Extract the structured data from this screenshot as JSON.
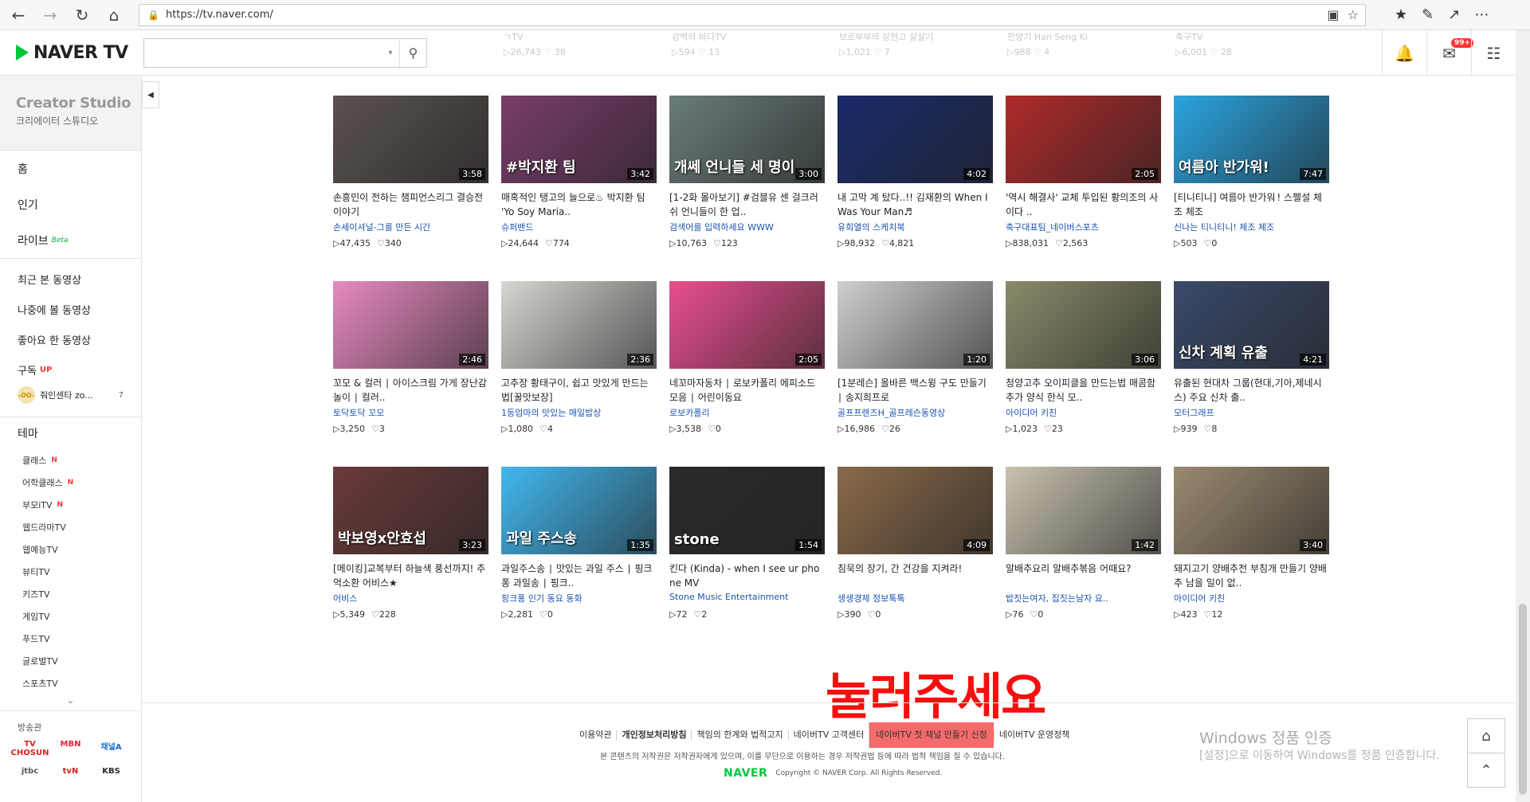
{
  "browser": {
    "url": "https://tv.naver.com/"
  },
  "header": {
    "logo": "NAVER TV",
    "search_placeholder": "",
    "badge": "99+",
    "ghost_row": [
      {
        "title": "ㄱTV",
        "stats": "▷26,743  ♡ 38"
      },
      {
        "title": "강백의 바다TV",
        "stats": "▷594  ♡ 13"
      },
      {
        "title": "브로부부의 장현고 살살기",
        "stats": "▷1,021  ♡ 7"
      },
      {
        "title": "한양기 Han Seng Ki",
        "stats": "▷988  ♡ 4"
      },
      {
        "title": "축구TV",
        "stats": "▷6,001  ♡ 28"
      }
    ]
  },
  "sidebar": {
    "studio_title": "Creator Studio",
    "studio_sub": "크리에이터 스튜디오",
    "home": "홈",
    "popular": "인기",
    "live": "라이브",
    "live_badge": "Beta",
    "recent": "최근 본 동영상",
    "later": "나중에 볼 동영상",
    "liked": "좋아요 한 동영상",
    "subscribe": "구독",
    "subscribe_badge": "UP",
    "sub_channel": "줘인센타 zo...",
    "sub_avatar": "-OO-",
    "sub_count": "7",
    "theme": "테마",
    "themes": [
      {
        "label": "클래스",
        "badge": "N"
      },
      {
        "label": "어학클래스",
        "badge": "N"
      },
      {
        "label": "부모iTV",
        "badge": "N"
      },
      {
        "label": "웹드라마TV",
        "badge": ""
      },
      {
        "label": "웹예능TV",
        "badge": ""
      },
      {
        "label": "뷰티TV",
        "badge": ""
      },
      {
        "label": "키즈TV",
        "badge": ""
      },
      {
        "label": "게임TV",
        "badge": ""
      },
      {
        "label": "푸드TV",
        "badge": ""
      },
      {
        "label": "글로벌TV",
        "badge": ""
      },
      {
        "label": "스포츠TV",
        "badge": ""
      }
    ],
    "broadcast_title": "방송관",
    "broadcasters": [
      "TV CHOSUN",
      "MBN",
      "채널A",
      "jtbc",
      "tvN",
      "KBS"
    ],
    "broadcaster_colors": [
      "#d22",
      "#e23",
      "#1a6bd1",
      "#555",
      "#c22",
      "#2a2a2a"
    ]
  },
  "videos": [
    {
      "title": "손흥민이 전하는 챔피언스리그 결승전 이야기",
      "channel": "손세이셔널-그를 만든 시간",
      "views": "▷47,435",
      "likes": "♡340",
      "duration": "3:58",
      "color": "#5a5250",
      "caption": ""
    },
    {
      "title": "매혹적인 탱고의 늘으로♨ 박지환 팀 'Yo Soy Maria..",
      "channel": "슈퍼밴드",
      "views": "▷24,644",
      "likes": "♡774",
      "duration": "3:42",
      "color": "#7a3d6b",
      "caption": "#박지환 팀"
    },
    {
      "title": "[1-2화 몰아보기] #검블유 센 걸크러쉬 언니들이 한 업..",
      "channel": "검색어를 입력하세요 WWW",
      "views": "▷10,763",
      "likes": "♡123",
      "duration": "3:00",
      "color": "#6a7c7a",
      "caption": "개쎄 언니들 세 명이"
    },
    {
      "title": "내 고막 계 탔다..!! 김재환의 When I Was Your Man♬",
      "channel": "유희열의 스케치북",
      "views": "▷98,932",
      "likes": "♡4,821",
      "duration": "4:02",
      "color": "#1a2a6a",
      "caption": ""
    },
    {
      "title": "'역시 해결사' 교체 투입된 황의조의 사이다 ..",
      "channel": "축구대표팀_네이버스포츠",
      "views": "▷838,031",
      "likes": "♡2,563",
      "duration": "2:05",
      "color": "#b02a2a",
      "caption": ""
    },
    {
      "title": "[티니티니] 여름아 반가워 ! 스펠설 체조 체조",
      "channel": "신나는 티니티니! 체조 체조",
      "views": "▷503",
      "likes": "♡0",
      "duration": "7:47",
      "color": "#2aa4e0",
      "caption": "여름아 반가워!"
    },
    {
      "title": "꼬모 & 컬러 ∣ 아이스크림 가게 장난감 놀이 ∣ 컬러..",
      "channel": "토닥토닥 꼬모",
      "views": "▷3,250",
      "likes": "♡3",
      "duration": "2:46",
      "color": "#e88ac0",
      "caption": ""
    },
    {
      "title": "고추장 황태구이, 쉽고 맛있게 만드는법[꿀맛보장]",
      "channel": "1등엄마의 맛있는 매일밥상",
      "views": "▷1,080",
      "likes": "♡4",
      "duration": "2:36",
      "color": "#d8d6d2",
      "caption": ""
    },
    {
      "title": "네꼬마자동차 ∣ 로보카폴리 에피소드 모음 ∣ 어린이동요",
      "channel": "로보카폴리",
      "views": "▷3,538",
      "likes": "♡0",
      "duration": "2:05",
      "color": "#e94e8e",
      "caption": ""
    },
    {
      "title": "[1분레슨] 올바른 백스윙 구도 만들기 ∣ 송지희프로",
      "channel": "골프프렌즈H_골프레슨동영상",
      "views": "▷16,986",
      "likes": "♡26",
      "duration": "1:20",
      "color": "#cfcfcf",
      "caption": ""
    },
    {
      "title": "청양고추 오이피클을 만드는법 매콤함 추가 양식 한식 모..",
      "channel": "아이디어 키친",
      "views": "▷1,023",
      "likes": "♡23",
      "duration": "3:06",
      "color": "#8a8a6a",
      "caption": ""
    },
    {
      "title": "유출된 현대차 그룹(현대,기아,제네시스) 주요 신차 출..",
      "channel": "모터그래프",
      "views": "▷939",
      "likes": "♡8",
      "duration": "4:21",
      "color": "#3a4a6a",
      "caption": "신차 계획 유출"
    },
    {
      "title": "[메이킹]교복부터 하늘색 풍선까지! 추억소환 어비스★",
      "channel": "어비스",
      "views": "▷5,349",
      "likes": "♡228",
      "duration": "3:23",
      "color": "#6a3a3a",
      "caption": "박보영x안효섭"
    },
    {
      "title": "과일주스송 ∣ 맛있는 과일 주스 ∣ 핑크퐁 과일송 ∣ 핑크..",
      "channel": "핑크퐁 인기 동요 동화",
      "views": "▷2,281",
      "likes": "♡0",
      "duration": "1:35",
      "color": "#42b8f0",
      "caption": "과일 주스송"
    },
    {
      "title": "킨다 (Kinda) - when I see ur phone MV",
      "channel": "Stone Music Entertainment",
      "views": "▷72",
      "likes": "♡2",
      "duration": "1:54",
      "color": "#2a2a2a",
      "caption": "stone"
    },
    {
      "title": "침묵의 장기, 간 건강을 지켜라!",
      "channel": "생생경제 정보톡톡",
      "views": "▷390",
      "likes": "♡0",
      "duration": "4:09",
      "color": "#8a6a4a",
      "caption": ""
    },
    {
      "title": "알배추요리 알배추볶음 어때요?",
      "channel": "밥짓는여자, 집짓는남자 요..",
      "views": "▷76",
      "likes": "♡0",
      "duration": "1:42",
      "color": "#c8c2b0",
      "caption": ""
    },
    {
      "title": "돼지고기 양배추전 부침개 만들기 양배추 남을 일이 없..",
      "channel": "아이디어 키친",
      "views": "▷423",
      "likes": "♡12",
      "duration": "3:40",
      "color": "#9a8a70",
      "caption": ""
    }
  ],
  "overlay_text": "눌러주세요",
  "footer": {
    "links": [
      {
        "label": "이용약관",
        "style": ""
      },
      {
        "label": "개인정보처리방침",
        "style": "bold"
      },
      {
        "label": "책임의 한계와 법적고지",
        "style": ""
      },
      {
        "label": "네이버TV 고객센터",
        "style": ""
      },
      {
        "label": "네이버TV 첫 채널 만들기 신청",
        "style": "hl"
      },
      {
        "label": "네이버TV 운영정책",
        "style": ""
      }
    ],
    "notice": "본 콘텐츠의 저작권은 저작권자에게 있으며, 이를 무단으로 이용하는 경우 저작권법 등에 따라 법적 책임을 질 수 있습니다.",
    "naver": "NAVER",
    "copyright": "Copyright © NAVER Corp. All Rights Reserved."
  },
  "windows": {
    "line1": "Windows 정품 인증",
    "line2": "[설정]으로 이동하여 Windows를 정품 인증합니다."
  }
}
